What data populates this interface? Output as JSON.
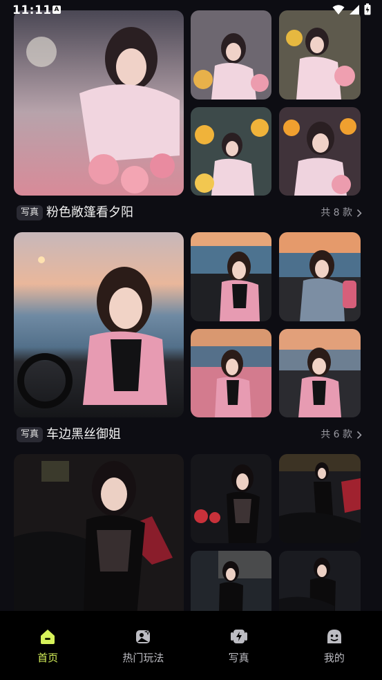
{
  "status_bar": {
    "time": "11:11",
    "notification_glyph": "A"
  },
  "sets": [
    {
      "tag": "写真",
      "title": "粉色敞篷看夕阳",
      "count": "共 8 款"
    },
    {
      "tag": "写真",
      "title": "车边黑丝御姐",
      "count": "共 6 款"
    }
  ],
  "nav": {
    "items": [
      {
        "label": "首页",
        "icon": "home-icon",
        "active": true
      },
      {
        "label": "热门玩法",
        "icon": "magic-photo-icon",
        "active": false
      },
      {
        "label": "写真",
        "icon": "portrait-album-icon",
        "active": false
      },
      {
        "label": "我的",
        "icon": "profile-icon",
        "active": false
      }
    ]
  },
  "colors": {
    "background": "#0d0d13",
    "accent": "#d6f25a",
    "nav_background": "#000000"
  }
}
